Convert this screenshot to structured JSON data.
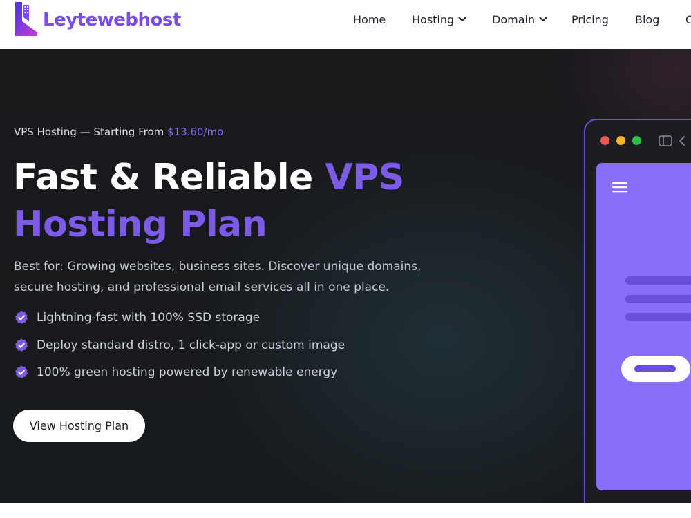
{
  "brand": {
    "name": "Leytewebhost",
    "colors": {
      "accent": "#7c5ce6",
      "price": "#8a6cf5",
      "logo_gradient": [
        "#5a3df0",
        "#c43fd6"
      ]
    }
  },
  "nav": {
    "items": [
      {
        "label": "Home",
        "has_dropdown": false
      },
      {
        "label": "Hosting",
        "has_dropdown": true,
        "icon": "chevron-down-icon"
      },
      {
        "label": "Domain",
        "has_dropdown": true,
        "icon": "chevron-down-icon"
      },
      {
        "label": "Pricing",
        "has_dropdown": false
      },
      {
        "label": "Blog",
        "has_dropdown": false
      },
      {
        "label": "C",
        "has_dropdown": false
      }
    ]
  },
  "hero": {
    "subline_prefix": "VPS Hosting — Starting From ",
    "subline_price": "$13.60/mo",
    "headline_white": "Fast & Reliable ",
    "headline_accent": "VPS Hosting Plan",
    "description": "Best for: Growing websites, business sites. Discover unique domains, secure hosting, and professional email services all in one place.",
    "features": [
      {
        "icon": "verified-check-badge-icon",
        "text": "Lightning-fast with 100% SSD storage"
      },
      {
        "icon": "verified-check-badge-icon",
        "text": "Deploy standard distro, 1 click-app or custom image"
      },
      {
        "icon": "verified-check-badge-icon",
        "text": "100% green hosting powered by renewable energy"
      }
    ],
    "cta_label": "View Hosting Plan"
  },
  "mockup": {
    "window_dots": [
      "#ee5a52",
      "#f4b52d",
      "#2fc048"
    ],
    "icons": [
      "sidebar-toggle-icon",
      "back-chevron-icon",
      "hamburger-menu-icon"
    ],
    "screen_color": "#8a6dfb"
  }
}
